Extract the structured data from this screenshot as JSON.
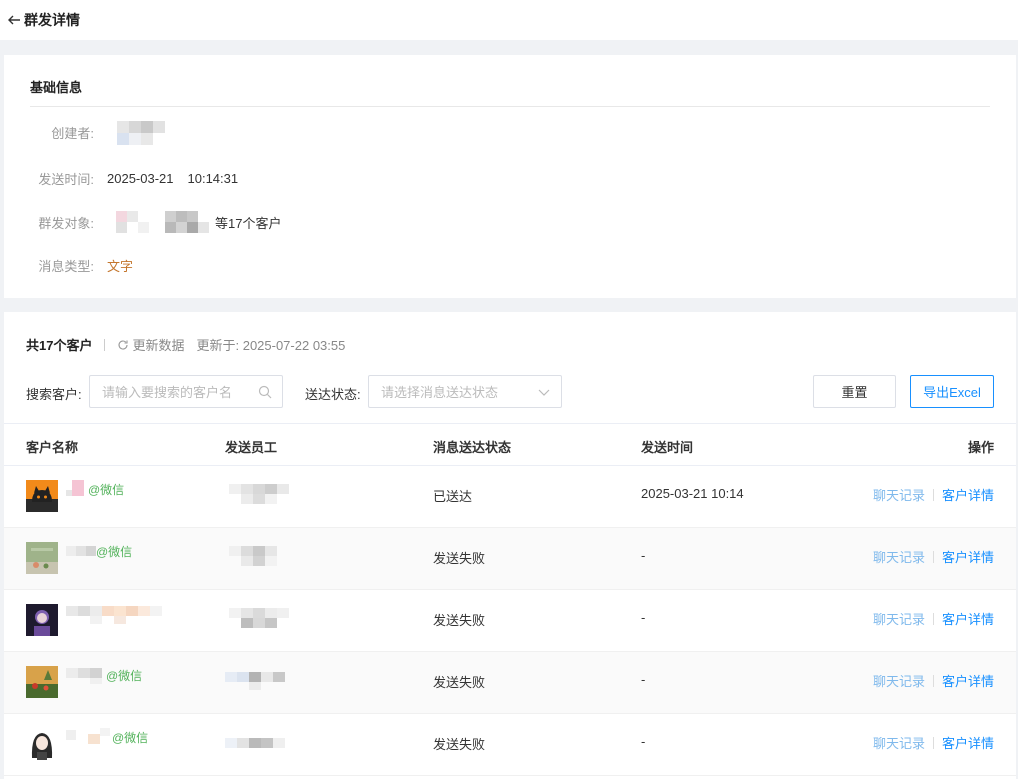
{
  "header": {
    "title": "群发详情",
    "back_icon": "arrow-left-icon"
  },
  "basic_info": {
    "section_title": "基础信息",
    "creator_label": "创建者:",
    "send_time_label": "发送时间:",
    "send_date": "2025-03-21",
    "send_clock": "10:14:31",
    "target_label": "群发对象:",
    "target_suffix": "等17个客户",
    "msg_type_label": "消息类型:",
    "msg_type_value": "文字",
    "msg_type_color": "#c4762d"
  },
  "summary": {
    "total": "共17个客户",
    "refresh_label": "更新数据",
    "updated_at": "更新于: 2025-07-22 03:55"
  },
  "filters": {
    "search_label": "搜索客户:",
    "search_placeholder": "请输入要搜索的客户名",
    "status_label": "送达状态:",
    "status_placeholder": "请选择消息送达状态",
    "reset_label": "重置",
    "export_label": "导出Excel"
  },
  "table": {
    "columns": [
      "客户名称",
      "发送员工",
      "消息送达状态",
      "发送时间",
      "操作"
    ],
    "rows": [
      {
        "suffix": "@微信",
        "status": "已送达",
        "time": "2025-03-21 10:14",
        "op1": "聊天记录",
        "op2": "客户详情"
      },
      {
        "suffix": "@微信",
        "status": "发送失败",
        "time": "-",
        "op1": "聊天记录",
        "op2": "客户详情"
      },
      {
        "suffix": "",
        "status": "发送失败",
        "time": "-",
        "op1": "聊天记录",
        "op2": "客户详情"
      },
      {
        "suffix": "@微信",
        "status": "发送失败",
        "time": "-",
        "op1": "聊天记录",
        "op2": "客户详情"
      },
      {
        "suffix": "@微信",
        "status": "发送失败",
        "time": "-",
        "op1": "聊天记录",
        "op2": "客户详情"
      }
    ]
  },
  "colors": {
    "primary": "#1890ff",
    "link_light": "#7fb9ec",
    "wechat_green": "#52b25a"
  }
}
